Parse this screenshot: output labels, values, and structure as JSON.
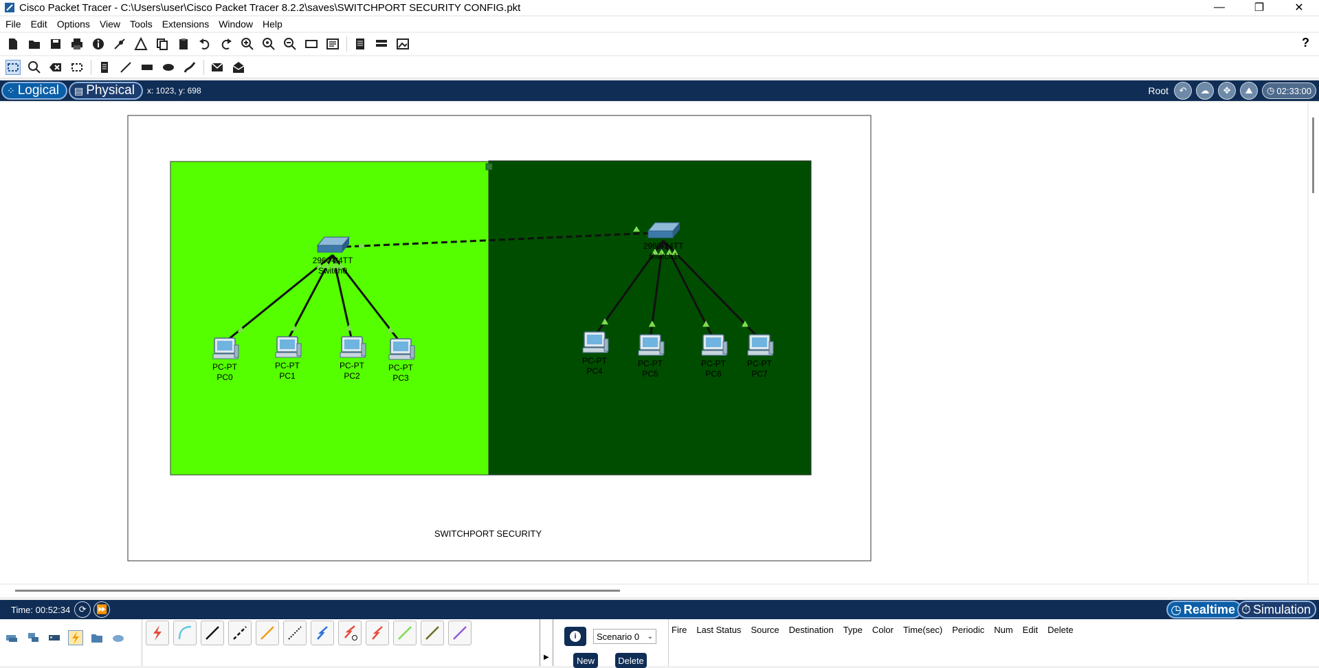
{
  "window": {
    "title": "Cisco Packet Tracer - C:\\Users\\user\\Cisco Packet Tracer 8.2.2\\saves\\SWITCHPORT SECURITY CONFIG.pkt",
    "minimize": "—",
    "maximize": "❐",
    "close": "✕"
  },
  "menu": {
    "file": "File",
    "edit": "Edit",
    "options": "Options",
    "view": "View",
    "tools": "Tools",
    "extensions": "Extensions",
    "window": "Window",
    "help": "Help"
  },
  "help_button": "?",
  "nav": {
    "logical": "Logical",
    "physical": "Physical",
    "coords": "x: 1023, y: 698",
    "root": "Root",
    "clock": "02:33:00"
  },
  "canvas": {
    "annotation": "SWITCHPORT SECURITY",
    "colors": {
      "left_zone": "#55ff00",
      "right_zone": "#004d00",
      "link": "#111111",
      "link_indicator": "#7ddc4f"
    },
    "switches": [
      {
        "model": "2960-24TT",
        "name": "Switch0"
      },
      {
        "model": "2960-24TT",
        "name": "Switch1"
      }
    ],
    "pcs": [
      {
        "model": "PC-PT",
        "name": "PC0"
      },
      {
        "model": "PC-PT",
        "name": "PC1"
      },
      {
        "model": "PC-PT",
        "name": "PC2"
      },
      {
        "model": "PC-PT",
        "name": "PC3"
      },
      {
        "model": "PC-PT",
        "name": "PC4"
      },
      {
        "model": "PC-PT",
        "name": "PC5"
      },
      {
        "model": "PC-PT",
        "name": "PC6"
      },
      {
        "model": "PC-PT",
        "name": "PC7"
      }
    ]
  },
  "timebar": {
    "time": "Time: 00:52:34",
    "realtime": "Realtime",
    "simulation": "Simulation"
  },
  "scenario": {
    "selected": "Scenario 0",
    "new": "New",
    "delete": "Delete",
    "info_icon": "i"
  },
  "pdu_columns": [
    "Fire",
    "Last Status",
    "Source",
    "Destination",
    "Type",
    "Color",
    "Time(sec)",
    "Periodic",
    "Num",
    "Edit",
    "Delete"
  ]
}
